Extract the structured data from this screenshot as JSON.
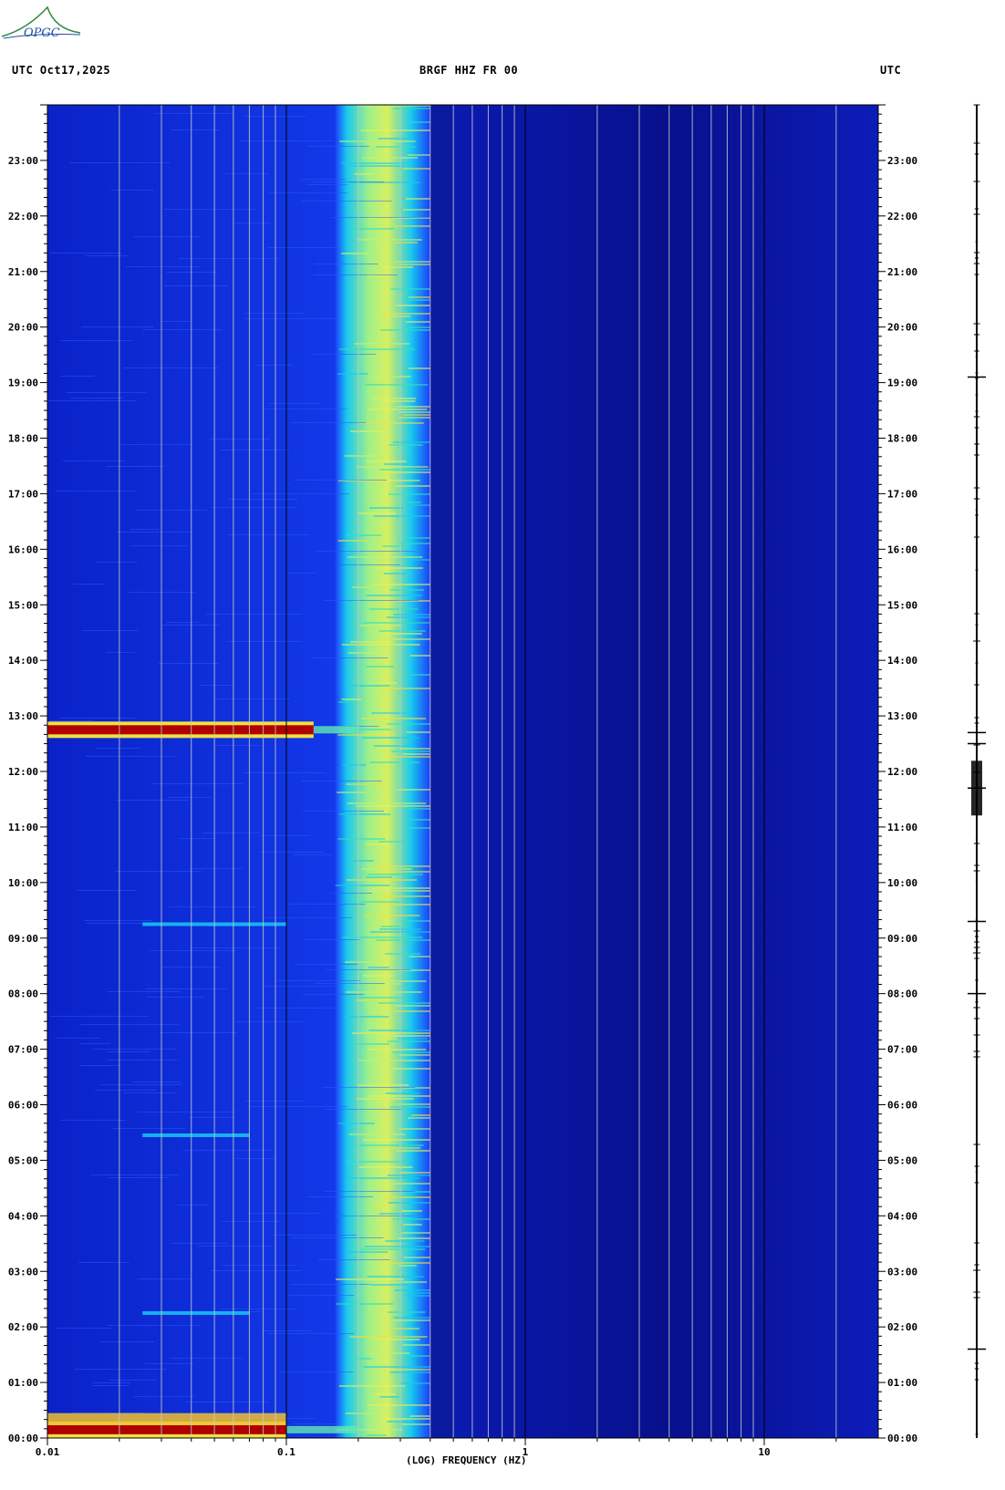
{
  "header": {
    "left": "UTC  Oct17,2025",
    "center": "BRGF HHZ FR 00",
    "right": "UTC"
  },
  "logo": {
    "text": "OPGC",
    "color": "#2e8b3a",
    "accent": "#1f4fa8"
  },
  "colors": {
    "background_blue": "#0a1a9e",
    "deep_blue": "#06108a",
    "mid_blue": "#1b3dfa",
    "cyan": "#19c8f0",
    "yellow": "#e8f05a",
    "red": "#b00000",
    "gridline": "#c8c8c8"
  },
  "chart_data": {
    "type": "heatmap",
    "title": "BRGF HHZ FR 00",
    "xlabel": "(LOG) FREQUENCY (HZ)",
    "ylabel": "UTC",
    "x_scale": "log",
    "xlim": [
      0.01,
      30
    ],
    "x_tick_labels": [
      "0.01",
      "0.1",
      "1",
      "10"
    ],
    "x_ticks": [
      0.01,
      0.1,
      1,
      10
    ],
    "x_minor_ticks": [
      0.02,
      0.03,
      0.04,
      0.05,
      0.06,
      0.07,
      0.08,
      0.09,
      0.2,
      0.3,
      0.4,
      0.5,
      0.6,
      0.7,
      0.8,
      0.9,
      2,
      3,
      4,
      5,
      6,
      7,
      8,
      9,
      20
    ],
    "ylim_hours": [
      0,
      24
    ],
    "y_tick_labels": [
      "00:00",
      "01:00",
      "02:00",
      "03:00",
      "04:00",
      "05:00",
      "06:00",
      "07:00",
      "08:00",
      "09:00",
      "10:00",
      "11:00",
      "12:00",
      "13:00",
      "14:00",
      "15:00",
      "16:00",
      "17:00",
      "18:00",
      "19:00",
      "20:00",
      "21:00",
      "22:00",
      "23:00"
    ],
    "y_ticks_hours": [
      0,
      1,
      2,
      3,
      4,
      5,
      6,
      7,
      8,
      9,
      10,
      11,
      12,
      13,
      14,
      15,
      16,
      17,
      18,
      19,
      20,
      21,
      22,
      23
    ],
    "microseism_band_hz": [
      0.16,
      0.4
    ],
    "events": [
      {
        "time_hours": 12.75,
        "f_max_hz": 0.13,
        "level": "high"
      },
      {
        "time_hours": 0.15,
        "f_max_hz": 0.1,
        "level": "high"
      },
      {
        "time_hours": 0.35,
        "f_max_hz": 0.1,
        "level": "medium"
      },
      {
        "time_hours": 5.45,
        "f_max_hz": 0.07,
        "level": "low"
      },
      {
        "time_hours": 9.25,
        "f_max_hz": 0.1,
        "level": "low"
      },
      {
        "time_hours": 2.25,
        "f_max_hz": 0.07,
        "level": "low"
      }
    ]
  },
  "trace": {
    "spike_hours": [
      19.1,
      12.7,
      12.5,
      11.7,
      9.3,
      8.0,
      1.6
    ]
  }
}
